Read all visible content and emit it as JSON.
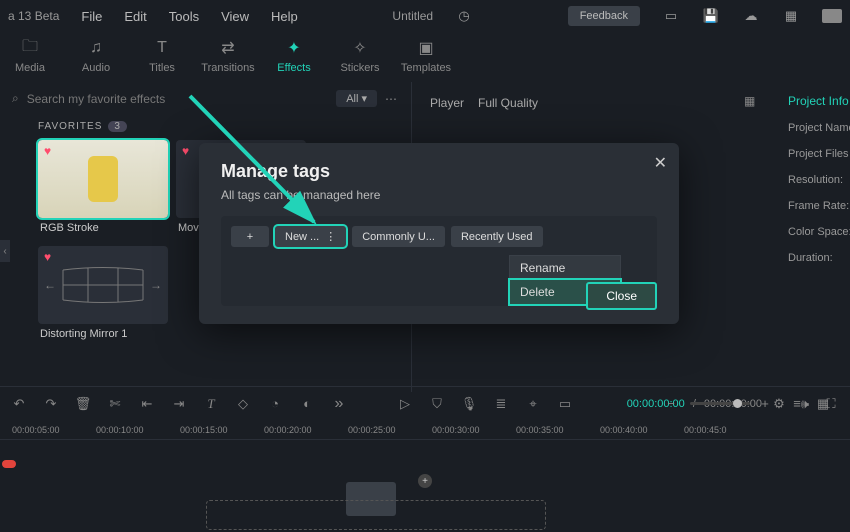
{
  "menubar": {
    "app": "a 13 Beta",
    "items": [
      "File",
      "Edit",
      "Tools",
      "View",
      "Help"
    ],
    "doc": "Untitled",
    "feedback": "Feedback"
  },
  "media_tabs": [
    {
      "icon": "folder",
      "label": "Media"
    },
    {
      "icon": "note",
      "label": "Audio"
    },
    {
      "icon": "T",
      "label": "Titles"
    },
    {
      "icon": "arrows",
      "label": "Transitions"
    },
    {
      "icon": "spark",
      "label": "Effects"
    },
    {
      "icon": "sticker",
      "label": "Stickers"
    },
    {
      "icon": "template",
      "label": "Templates"
    }
  ],
  "search": {
    "placeholder": "Search my favorite effects",
    "filter": "All"
  },
  "favorites": {
    "header": "FAVORITES",
    "count": "3"
  },
  "thumbs": [
    {
      "label": "RGB Stroke"
    },
    {
      "label": "Mov..."
    },
    {
      "label": "Distorting Mirror 1"
    }
  ],
  "player": {
    "label": "Player",
    "quality": "Full Quality"
  },
  "info": {
    "header": "Project Info",
    "rows": [
      "Project Name",
      "Project Files L",
      "Resolution:",
      "Frame Rate:",
      "Color Space:",
      "Duration:"
    ]
  },
  "modal": {
    "title": "Manage tags",
    "subtitle": "All tags can be managed here",
    "chips": [
      "New ...",
      "Commonly U...",
      "Recently Used"
    ],
    "context": [
      "Rename",
      "Delete"
    ],
    "close": "Close"
  },
  "transport": {
    "timecode_l": "00:00:00:00",
    "timecode_r": "00:00:00:00"
  },
  "ruler": [
    "00:00:05:00",
    "00:00:10:00",
    "00:00:15:00",
    "00:00:20:00",
    "00:00:25:00",
    "00:00:30:00",
    "00:00:35:00",
    "00:00:40:00",
    "00:00:45:0"
  ]
}
